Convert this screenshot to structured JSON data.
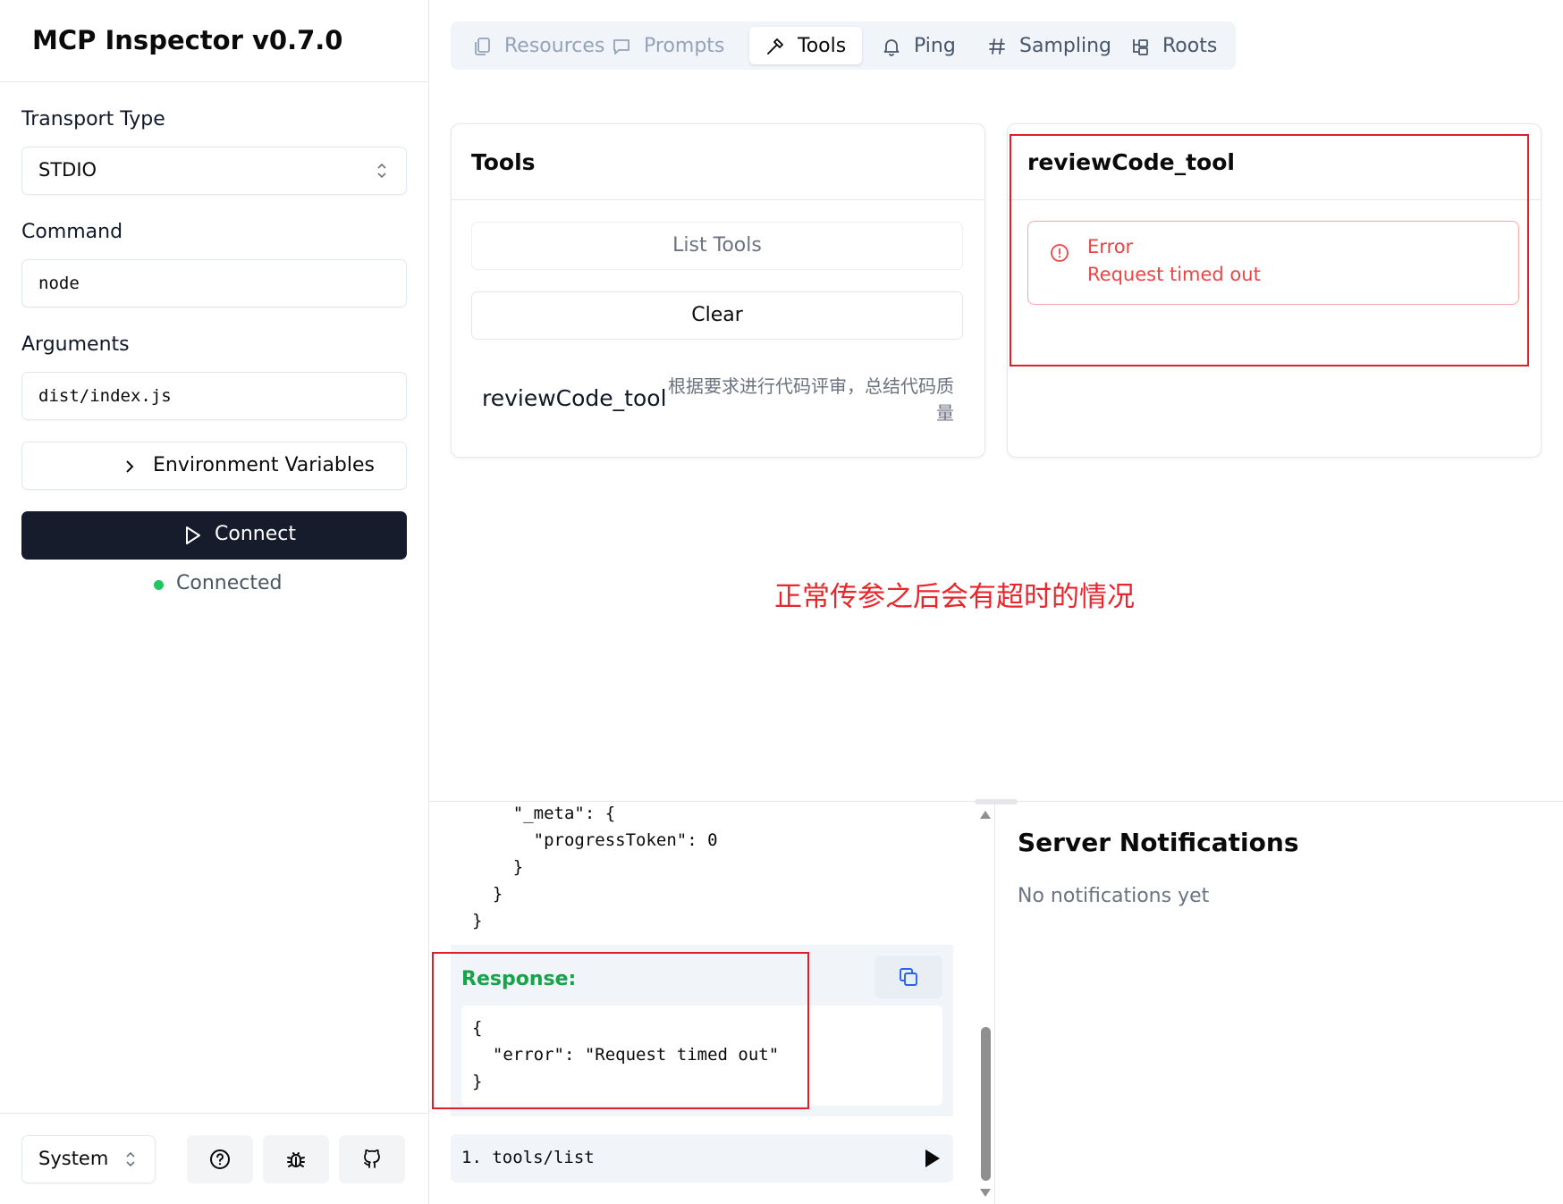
{
  "app": {
    "title": "MCP Inspector v0.7.0"
  },
  "sidebar": {
    "transport_label": "Transport Type",
    "transport_value": "STDIO",
    "command_label": "Command",
    "command_value": "node",
    "arguments_label": "Arguments",
    "arguments_value": "dist/index.js",
    "env_button": "Environment Variables",
    "connect_button": "Connect",
    "status": "Connected",
    "status_color": "#22c55e",
    "theme_value": "System",
    "footer_icons": [
      "help-icon",
      "bug-icon",
      "github-icon"
    ]
  },
  "tabs": [
    {
      "label": "Resources",
      "icon": "resources-icon",
      "state": "disabled"
    },
    {
      "label": "Prompts",
      "icon": "prompts-icon",
      "state": "disabled"
    },
    {
      "label": "Tools",
      "icon": "tools-icon",
      "state": "active"
    },
    {
      "label": "Ping",
      "icon": "bell-icon",
      "state": "normal"
    },
    {
      "label": "Sampling",
      "icon": "hash-icon",
      "state": "normal"
    },
    {
      "label": "Roots",
      "icon": "roots-icon",
      "state": "normal"
    }
  ],
  "tools_panel": {
    "title": "Tools",
    "list_button": "List Tools",
    "clear_button": "Clear",
    "tool_name": "reviewCode_tool",
    "tool_description": "根据要求进行代码评审，总结代码质量"
  },
  "tool_detail": {
    "title": "reviewCode_tool",
    "error_title": "Error",
    "error_message": "Request timed out",
    "error_color": "#ef4444"
  },
  "annotation": "正常传参之后会有超时的情况",
  "history": {
    "request_lines": [
      "    \"_meta\": {",
      "      \"progressToken\": 0",
      "    }",
      "  }",
      "}"
    ],
    "response_label": "Response:",
    "response_lines": [
      "{",
      "  \"error\": \"Request timed out\"",
      "}"
    ],
    "item": "1. tools/list"
  },
  "notifications": {
    "title": "Server Notifications",
    "empty": "No notifications yet"
  }
}
